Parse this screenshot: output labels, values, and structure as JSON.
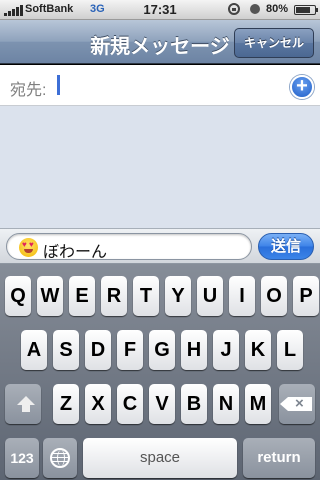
{
  "status_bar": {
    "carrier": "SoftBank",
    "network": "3G",
    "time": "17:31",
    "battery_percent": "80%",
    "battery_level": 0.8,
    "signal_bars": 5
  },
  "navbar": {
    "title": "新規メッセージ",
    "cancel_label": "キャンセル"
  },
  "to_field": {
    "label": "宛先:",
    "value": ""
  },
  "compose": {
    "text": "ぼわーん",
    "emoji": "heart-eyes-smiley",
    "send_label": "送信"
  },
  "keyboard": {
    "row1": [
      "Q",
      "W",
      "E",
      "R",
      "T",
      "Y",
      "U",
      "I",
      "O",
      "P"
    ],
    "row2": [
      "A",
      "S",
      "D",
      "F",
      "G",
      "H",
      "J",
      "K",
      "L"
    ],
    "row3": [
      "Z",
      "X",
      "C",
      "V",
      "B",
      "N",
      "M"
    ],
    "numbers_label": "123",
    "space_label": "space",
    "return_label": "return"
  },
  "colors": {
    "nav_blue": "#7d93b0",
    "send_blue": "#2a6fdb",
    "message_bg": "#dbe2ed",
    "cursor": "#3d6fd6"
  }
}
